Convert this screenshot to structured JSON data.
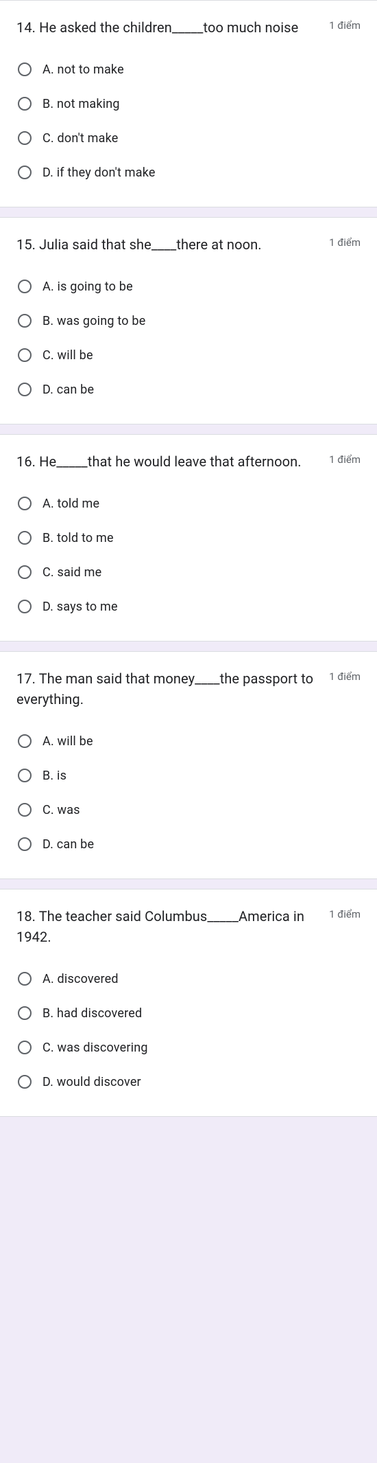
{
  "points_label": "1 điểm",
  "questions": [
    {
      "text": "14. He asked the children_____too much noise",
      "options": [
        "A. not to make",
        "B. not making",
        "C. don't make",
        "D. if they don't make"
      ]
    },
    {
      "text": "15. Julia said that she____there at noon.",
      "options": [
        "A. is going to be",
        "B. was going to be",
        "C. will be",
        "D. can be"
      ]
    },
    {
      "text": "16. He_____that he would leave that afternoon.",
      "options": [
        "A. told me",
        "B. told to me",
        "C. said me",
        "D. says to me"
      ]
    },
    {
      "text": "17. The man said that money____the passport to everything.",
      "options": [
        "A. will be",
        "B. is",
        "C. was",
        "D. can be"
      ]
    },
    {
      "text": "18. The teacher said Columbus_____America in 1942.",
      "options": [
        "A. discovered",
        "B. had discovered",
        "C. was discovering",
        "D. would discover"
      ]
    }
  ]
}
